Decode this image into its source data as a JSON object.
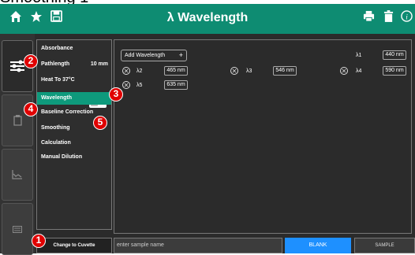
{
  "page_heading": "Smoothing 1",
  "topbar": {
    "title": "λ Wavelength",
    "home_icon": "home-icon",
    "favorite_icon": "star-icon",
    "save_icon": "save-icon",
    "print_icon": "print-icon",
    "delete_icon": "trash-icon",
    "info_icon": "info-icon"
  },
  "nav": [
    "settings-sliders-icon",
    "clipboard-icon",
    "chart-icon",
    "keyboard-icon"
  ],
  "menu": {
    "absorbance": "Absorbance",
    "pathlength": "Pathlength",
    "pathlength_value": "10 mm",
    "heat": "Heat To 37°C",
    "wavelength": "Wavelength",
    "baseline": "Baseline Correction",
    "smoothing": "Smoothing",
    "calculation": "Calculation",
    "manual_dilution": "Manual Dilution"
  },
  "content": {
    "add_wavelength": "Add Wavelength",
    "add_plus": "+",
    "wavelengths": [
      {
        "label": "λ1",
        "value": "440 nm"
      },
      {
        "label": "λ2",
        "value": "465 nm"
      },
      {
        "label": "λ3",
        "value": "546 nm"
      },
      {
        "label": "λ4",
        "value": "590 nm"
      },
      {
        "label": "λ5",
        "value": "635 nm"
      }
    ]
  },
  "bottom": {
    "change_cuvette": "Change to Cuvette",
    "sample_placeholder": "enter sample name",
    "blank": "BLANK",
    "sample": "SAMPLE"
  },
  "badges": [
    "1",
    "2",
    "3",
    "4",
    "5"
  ],
  "colors": {
    "accent": "#0e8c72",
    "selected": "#0e9a7c",
    "blank_button": "#1e90ff",
    "badge": "#e00000"
  }
}
